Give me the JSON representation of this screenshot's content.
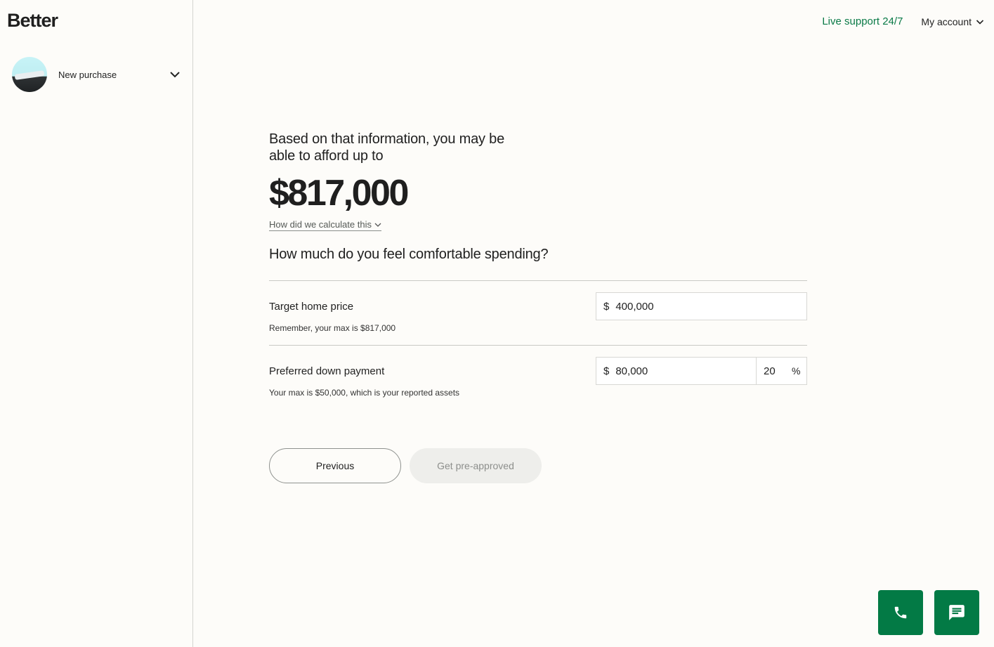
{
  "brand": {
    "logo_text": "Better"
  },
  "sidebar": {
    "loan_label": "New purchase"
  },
  "header": {
    "live_support": "Live support 24/7",
    "my_account": "My account"
  },
  "main": {
    "intro": "Based on that information, you may be able to afford up to",
    "max_amount": "$817,000",
    "calc_link": "How did we calculate this",
    "question": "How much do you feel comfortable spending?",
    "target_price": {
      "label": "Target home price",
      "hint": "Remember, your max is $817,000",
      "currency": "$",
      "value": "400,000"
    },
    "down_payment": {
      "label": "Preferred down payment",
      "hint": "Your max is $50,000, which is your reported assets",
      "currency": "$",
      "value": "80,000",
      "percent_value": "20",
      "percent_symbol": "%"
    }
  },
  "buttons": {
    "previous": "Previous",
    "next": "Get pre-approved"
  },
  "colors": {
    "accent_green": "#037a45",
    "link_green": "#0a7a47",
    "background": "#fdfcf9"
  },
  "icons": {
    "phone": "phone-icon",
    "chat": "chat-icon"
  }
}
